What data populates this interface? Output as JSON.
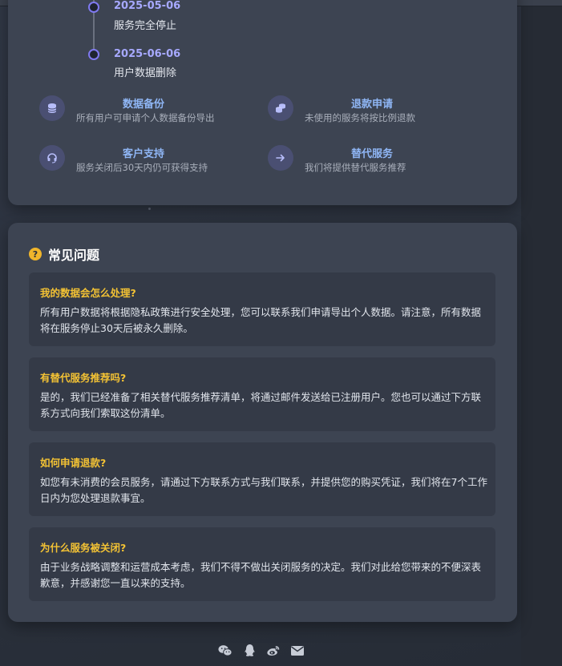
{
  "timeline": [
    {
      "date": "2025-05-06",
      "desc": "服务完全停止"
    },
    {
      "date": "2025-06-06",
      "desc": "用户数据删除"
    }
  ],
  "services": [
    {
      "icon": "database-icon",
      "title": "数据备份",
      "subtitle": "所有用户可申请个人数据备份导出"
    },
    {
      "icon": "coins-icon",
      "title": "退款申请",
      "subtitle": "未使用的服务将按比例退款"
    },
    {
      "icon": "headset-icon",
      "title": "客户支持",
      "subtitle": "服务关闭后30天内仍可获得支持"
    },
    {
      "icon": "arrow-right-icon",
      "title": "替代服务",
      "subtitle": "我们将提供替代服务推荐"
    }
  ],
  "faq": {
    "title": "常见问题",
    "items": [
      {
        "q": "我的数据会怎么处理?",
        "a": "所有用户数据将根据隐私政策进行安全处理，您可以联系我们申请导出个人数据。请注意，所有数据将在服务停止30天后被永久删除。"
      },
      {
        "q": "有替代服务推荐吗?",
        "a": "是的，我们已经准备了相关替代服务推荐清单，将通过邮件发送给已注册用户。您也可以通过下方联系方式向我们索取这份清单。"
      },
      {
        "q": "如何申请退款?",
        "a": "如您有未消费的会员服务，请通过下方联系方式与我们联系，并提供您的购买凭证，我们将在7个工作日内为您处理退款事宜。"
      },
      {
        "q": "为什么服务被关闭?",
        "a": "由于业务战略调整和运营成本考虑，我们不得不做出关闭服务的决定。我们对此给您带来的不便深表歉意，并感谢您一直以来的支持。"
      }
    ]
  },
  "footer": {
    "icons": [
      "wechat-icon",
      "qq-icon",
      "weibo-icon",
      "mail-icon"
    ]
  },
  "colors": {
    "accent_date": "#a7a9ff",
    "service_title": "#8fb6f5",
    "faq_question": "#f3c234"
  }
}
